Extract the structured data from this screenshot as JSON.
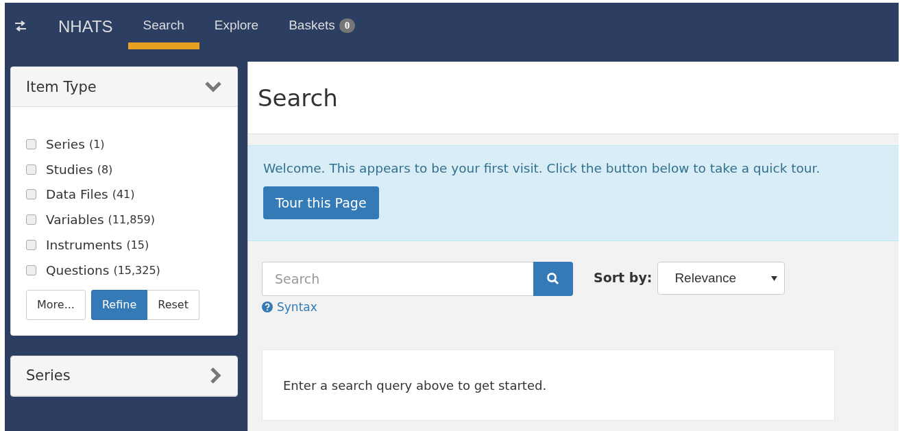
{
  "navbar": {
    "brand": "NHATS",
    "tabs": [
      {
        "label": "Search",
        "selected": true
      },
      {
        "label": "Explore",
        "selected": false
      },
      {
        "label": "Baskets",
        "selected": false,
        "badge": "0"
      }
    ]
  },
  "sidebar": {
    "panels": [
      {
        "title": "Item Type",
        "expanded": true,
        "items": [
          {
            "label": "Series",
            "count": "(1)",
            "checked": false
          },
          {
            "label": "Studies",
            "count": "(8)",
            "checked": false
          },
          {
            "label": "Data Files",
            "count": "(41)",
            "checked": false
          },
          {
            "label": "Variables",
            "count": "(11,859)",
            "checked": false
          },
          {
            "label": "Instruments",
            "count": "(15)",
            "checked": false
          },
          {
            "label": "Questions",
            "count": "(15,325)",
            "checked": false
          }
        ],
        "buttons": [
          {
            "label": "More...",
            "kind": "default"
          },
          {
            "label": "Refine",
            "kind": "primary"
          },
          {
            "label": "Reset",
            "kind": "default"
          }
        ]
      },
      {
        "title": "Series",
        "expanded": false
      }
    ]
  },
  "main": {
    "title": "Search",
    "alert": {
      "text": "Welcome. This appears to be your first visit. Click the button below to take a quick tour.",
      "button": "Tour this Page"
    },
    "search": {
      "placeholder": "Search",
      "syntax_link": "Syntax",
      "sort_label": "Sort by:",
      "sort_value": "Relevance"
    },
    "empty_message": "Enter a search query above to get started."
  }
}
